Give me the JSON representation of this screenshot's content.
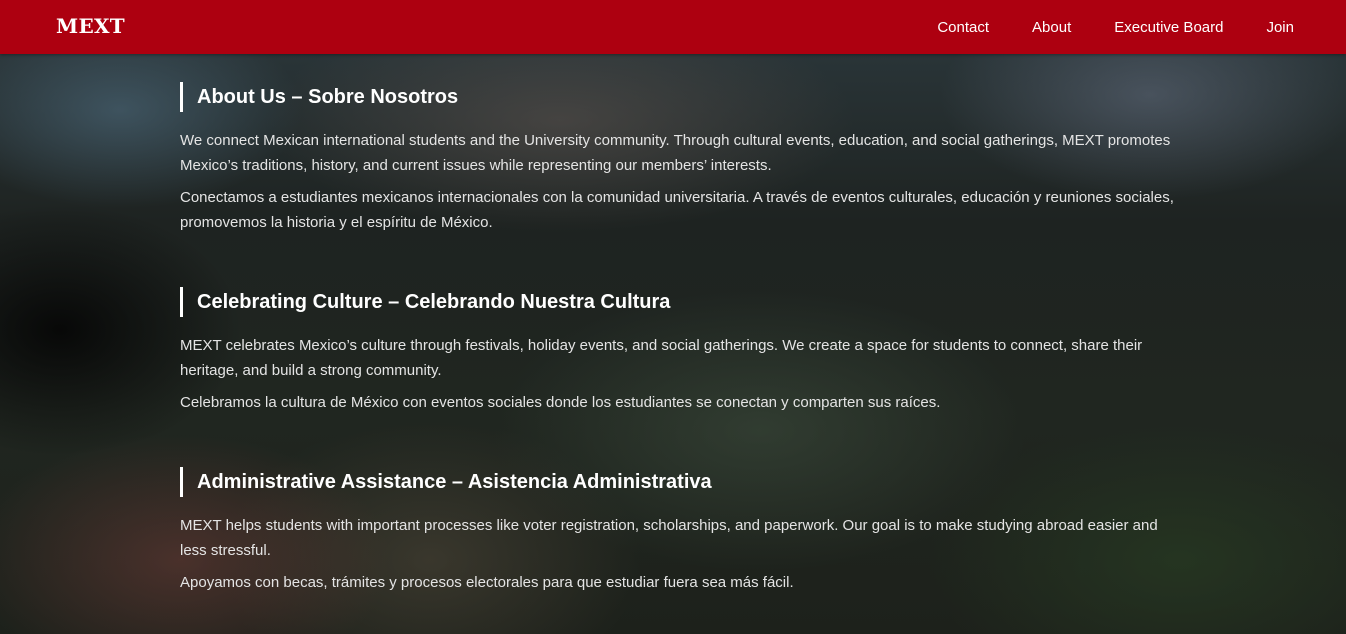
{
  "colors": {
    "navbar_background": "#ad0010",
    "text_primary": "#ffffff",
    "text_body": "#e4e4e4"
  },
  "navbar": {
    "brand": "MEXT",
    "links": [
      {
        "label": "Contact"
      },
      {
        "label": "About"
      },
      {
        "label": "Executive Board"
      },
      {
        "label": "Join"
      }
    ]
  },
  "sections": [
    {
      "title": "About Us – Sobre Nosotros",
      "paragraphs": [
        "We connect Mexican international students and the University community. Through cultural events, education, and social gatherings, MEXT promotes Mexico’s traditions, history, and current issues while representing our members’ interests.",
        "Conectamos a estudiantes mexicanos internacionales con la comunidad universitaria. A través de eventos culturales, educación y reuniones sociales, promovemos la historia y el espíritu de México."
      ]
    },
    {
      "title": "Celebrating Culture – Celebrando Nuestra Cultura",
      "paragraphs": [
        "MEXT celebrates Mexico’s culture through festivals, holiday events, and social gatherings. We create a space for students to connect, share their heritage, and build a strong community.",
        "Celebramos la cultura de México con eventos sociales donde los estudiantes se conectan y comparten sus raíces."
      ]
    },
    {
      "title": "Administrative Assistance – Asistencia Administrativa",
      "paragraphs": [
        "MEXT helps students with important processes like voter registration, scholarships, and paperwork. Our goal is to make studying abroad easier and less stressful.",
        "Apoyamos con becas, trámites y procesos electorales para que estudiar fuera sea más fácil."
      ]
    }
  ]
}
